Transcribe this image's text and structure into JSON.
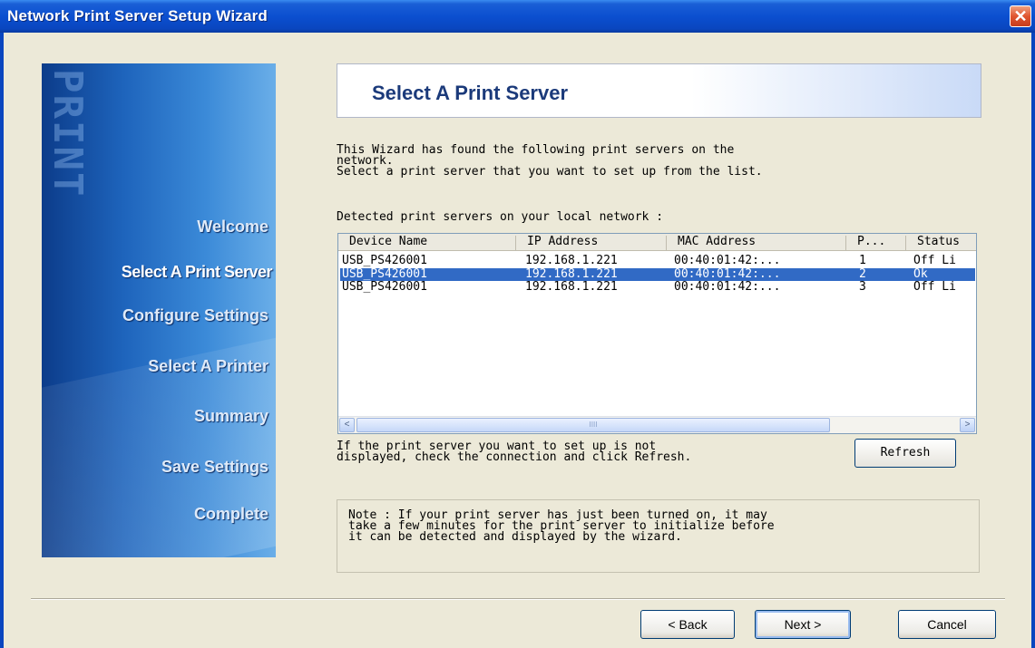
{
  "window": {
    "title": "Network Print Server Setup Wizard",
    "close_glyph": "✕"
  },
  "sidebar": {
    "logo_text": "PRINT",
    "steps": [
      {
        "label": "Welcome",
        "active": false
      },
      {
        "label": "Select A Print Server",
        "active": true
      },
      {
        "label": "Configure Settings",
        "active": false
      },
      {
        "label": "Select  A  Printer",
        "active": false
      },
      {
        "label": "Summary",
        "active": false
      },
      {
        "label": "Save Settings",
        "active": false
      },
      {
        "label": "Complete",
        "active": false
      }
    ]
  },
  "header": {
    "title": "Select A Print Server"
  },
  "description": "This Wizard has found the following print servers on the\nnetwork.\nSelect a print server that you want to set up from the list.",
  "list": {
    "label": "Detected print servers on your local network :",
    "columns": [
      "Device Name",
      "IP Address",
      "MAC Address",
      "P...",
      "Status"
    ],
    "rows": [
      [
        "USB_PS426001",
        "192.168.1.221",
        "00:40:01:42:...",
        "1",
        "Off Li"
      ],
      [
        "USB_PS426001",
        "192.168.1.221",
        "00:40:01:42:...",
        "2",
        "Ok"
      ],
      [
        "USB_PS426001",
        "192.168.1.221",
        "00:40:01:42:...",
        "3",
        "Off Li"
      ]
    ],
    "selected_row": 1,
    "scroll_left": "<",
    "scroll_right": ">",
    "scroll_grip": "IIII"
  },
  "refresh_hint": "If the print server you want to set up is not\ndisplayed, check the connection and click Refresh.",
  "refresh_button": "Refresh",
  "note": "Note : If your print server has just been turned on, it may\ntake a few minutes for the print server to initialize before\nit can be detected and displayed by the wizard.",
  "buttons": {
    "back": "< Back",
    "next": "Next >",
    "cancel": "Cancel"
  }
}
